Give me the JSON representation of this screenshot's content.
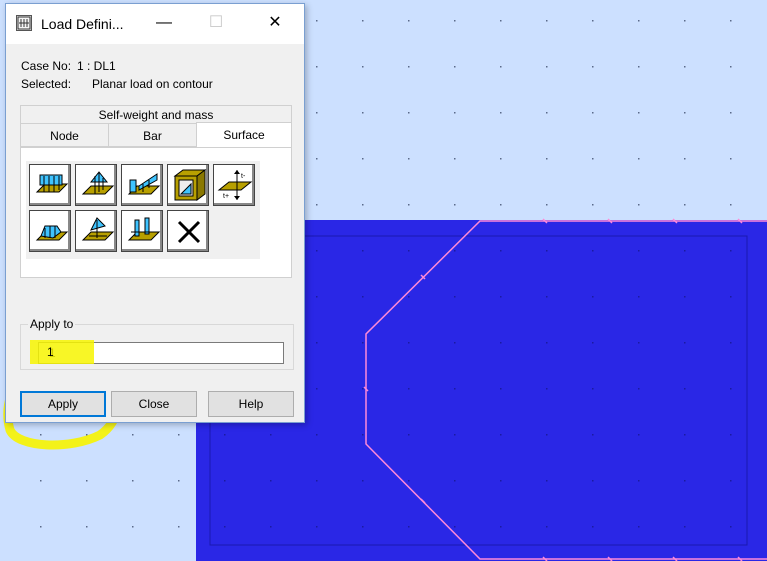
{
  "window": {
    "title": "Load Defini...",
    "minimize_glyph": "—",
    "maximize_glyph": "☐",
    "close_glyph": "✕"
  },
  "info": {
    "case_label": "Case No:",
    "case_value": "1 : DL1",
    "selected_label": "Selected:",
    "selected_value": "Planar load on contour"
  },
  "tabs": {
    "top_label": "Self-weight and mass",
    "items": [
      "Node",
      "Bar",
      "Surface"
    ],
    "active": "Surface"
  },
  "tools": [
    {
      "icon": "uniform-planar-load-icon"
    },
    {
      "icon": "planar-load-3-points-icon"
    },
    {
      "icon": "linear-load-on-edges-icon"
    },
    {
      "icon": "hydrostatic-load-icon"
    },
    {
      "icon": "thermal-load-icon"
    },
    {
      "icon": "planar-load-on-contour-icon"
    },
    {
      "icon": "point-load-on-surface-icon"
    },
    {
      "icon": "linear-load-2-points-icon"
    },
    {
      "icon": "delete-load-icon"
    }
  ],
  "apply_to": {
    "legend": "Apply to",
    "value": "1"
  },
  "buttons": {
    "apply": "Apply",
    "close": "Close",
    "help": "Help"
  },
  "colors": {
    "canvas_bg": "#cce0ff",
    "panel_blue": "#2a27e6",
    "contour_pink": "#ff8ad8",
    "highlight_yellow": "#f7f400"
  }
}
